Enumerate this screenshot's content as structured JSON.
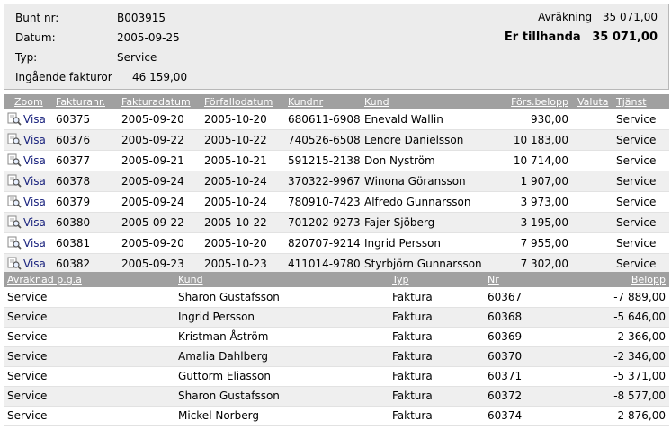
{
  "header": {
    "bunt_label": "Bunt nr:",
    "bunt_value": "B003915",
    "datum_label": "Datum:",
    "datum_value": "2005-09-25",
    "typ_label": "Typ:",
    "typ_value": "Service",
    "ingaende_label": "Ingående fakturor",
    "ingaende_value": "46 159,00",
    "avrakning_label": "Avräkning",
    "avrakning_value": "35 071,00",
    "tillhanda_label": "Er tillhanda",
    "tillhanda_value": "35 071,00"
  },
  "invoices": {
    "columns": {
      "zoom": "Zoom",
      "fakturanr": "Fakturanr.",
      "fakturadatum": "Fakturadatum",
      "forfallodatum": "Förfallodatum",
      "kundnr": "Kundnr",
      "kund": "Kund",
      "fors_belopp": "Förs.belopp",
      "valuta": "Valuta",
      "tjanst": "Tjänst"
    },
    "zoom_link_text": "Visa",
    "zoom_icon": "magnifier-icon",
    "rows": [
      {
        "fakturanr": "60375",
        "fakturadatum": "2005-09-20",
        "forfallodatum": "2005-10-20",
        "kundnr": "680611-6908",
        "kund": "Enevald Wallin",
        "fors_belopp": "930,00",
        "valuta": "",
        "tjanst": "Service"
      },
      {
        "fakturanr": "60376",
        "fakturadatum": "2005-09-22",
        "forfallodatum": "2005-10-22",
        "kundnr": "740526-6508",
        "kund": "Lenore Danielsson",
        "fors_belopp": "10 183,00",
        "valuta": "",
        "tjanst": "Service"
      },
      {
        "fakturanr": "60377",
        "fakturadatum": "2005-09-21",
        "forfallodatum": "2005-10-21",
        "kundnr": "591215-2138",
        "kund": "Don Nyström",
        "fors_belopp": "10 714,00",
        "valuta": "",
        "tjanst": "Service"
      },
      {
        "fakturanr": "60378",
        "fakturadatum": "2005-09-24",
        "forfallodatum": "2005-10-24",
        "kundnr": "370322-9967",
        "kund": "Winona Göransson",
        "fors_belopp": "1 907,00",
        "valuta": "",
        "tjanst": "Service"
      },
      {
        "fakturanr": "60379",
        "fakturadatum": "2005-09-24",
        "forfallodatum": "2005-10-24",
        "kundnr": "780910-7423",
        "kund": "Alfredo Gunnarsson",
        "fors_belopp": "3 973,00",
        "valuta": "",
        "tjanst": "Service"
      },
      {
        "fakturanr": "60380",
        "fakturadatum": "2005-09-22",
        "forfallodatum": "2005-10-22",
        "kundnr": "701202-9273",
        "kund": "Fajer Sjöberg",
        "fors_belopp": "3 195,00",
        "valuta": "",
        "tjanst": "Service"
      },
      {
        "fakturanr": "60381",
        "fakturadatum": "2005-09-20",
        "forfallodatum": "2005-10-20",
        "kundnr": "820707-9214",
        "kund": "Ingrid Persson",
        "fors_belopp": "7 955,00",
        "valuta": "",
        "tjanst": "Service"
      },
      {
        "fakturanr": "60382",
        "fakturadatum": "2005-09-23",
        "forfallodatum": "2005-10-23",
        "kundnr": "411014-9780",
        "kund": "Styrbjörn Gunnarsson",
        "fors_belopp": "7 302,00",
        "valuta": "",
        "tjanst": "Service"
      }
    ]
  },
  "credits": {
    "columns": {
      "avraknad": "Avräknad p.g.a",
      "kund": "Kund",
      "typ": "Typ",
      "nr": "Nr",
      "belopp": "Belopp"
    },
    "rows": [
      {
        "avraknad": "Service",
        "kund": "Sharon Gustafsson",
        "typ": "Faktura",
        "nr": "60367",
        "belopp": "-7 889,00"
      },
      {
        "avraknad": "Service",
        "kund": "Ingrid Persson",
        "typ": "Faktura",
        "nr": "60368",
        "belopp": "-5 646,00"
      },
      {
        "avraknad": "Service",
        "kund": "Kristman Åström",
        "typ": "Faktura",
        "nr": "60369",
        "belopp": "-2 366,00"
      },
      {
        "avraknad": "Service",
        "kund": "Amalia Dahlberg",
        "typ": "Faktura",
        "nr": "60370",
        "belopp": "-2 346,00"
      },
      {
        "avraknad": "Service",
        "kund": "Guttorm Eliasson",
        "typ": "Faktura",
        "nr": "60371",
        "belopp": "-5 371,00"
      },
      {
        "avraknad": "Service",
        "kund": "Sharon Gustafsson",
        "typ": "Faktura",
        "nr": "60372",
        "belopp": "-8 577,00"
      },
      {
        "avraknad": "Service",
        "kund": "Mickel Norberg",
        "typ": "Faktura",
        "nr": "60374",
        "belopp": "-2 876,00"
      }
    ]
  }
}
